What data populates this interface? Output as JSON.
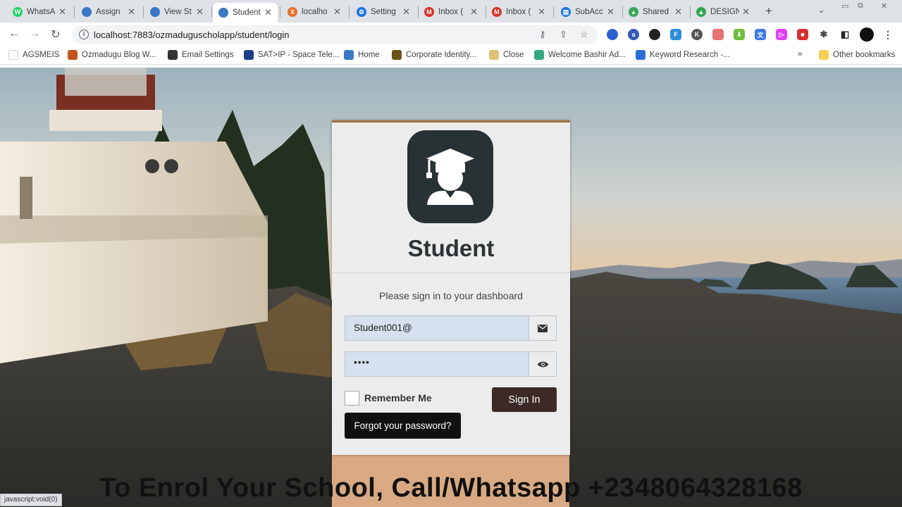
{
  "browser": {
    "tabs": [
      {
        "label": "WhatsA",
        "icon": "whatsapp-icon",
        "color": "#25d366",
        "glyph": "W"
      },
      {
        "label": "Assign",
        "icon": "globe-icon",
        "color": "#3b78c4",
        "glyph": ""
      },
      {
        "label": "View St",
        "icon": "globe-icon",
        "color": "#3b78c4",
        "glyph": ""
      },
      {
        "label": "Student",
        "icon": "globe-icon",
        "color": "#3b78c4",
        "glyph": "",
        "active": true
      },
      {
        "label": "localho",
        "icon": "xampp-icon",
        "color": "#e8702a",
        "glyph": "X"
      },
      {
        "label": "Setting",
        "icon": "gear-icon",
        "color": "#1a73e8",
        "glyph": "⚙"
      },
      {
        "label": "Inbox (",
        "icon": "gmail-icon",
        "color": "#d93025",
        "glyph": "M"
      },
      {
        "label": "Inbox (",
        "icon": "gmail-icon",
        "color": "#d93025",
        "glyph": "M"
      },
      {
        "label": "SubAcc",
        "icon": "sheet-icon",
        "color": "#1a73e8",
        "glyph": "▤"
      },
      {
        "label": "Shared",
        "icon": "drive-icon",
        "color": "#34a853",
        "glyph": "▲"
      },
      {
        "label": "DESIGN",
        "icon": "drive-icon",
        "color": "#34a853",
        "glyph": "▲"
      }
    ],
    "url": "localhost:7883/ozmaduguscholapp/student/login",
    "bookmarks": [
      {
        "label": "AGSMEIS",
        "icon": "bookmark-blank-icon",
        "color": "#ffffff"
      },
      {
        "label": "Ozmadugu Blog W...",
        "icon": "blog-icon",
        "color": "#c0561e"
      },
      {
        "label": "Email Settings",
        "icon": "settings-icon",
        "color": "#333333"
      },
      {
        "label": "SAT>IP - Space Tele...",
        "icon": "satellite-icon",
        "color": "#1d3c8a"
      },
      {
        "label": "Home",
        "icon": "globe-icon",
        "color": "#3b78c4"
      },
      {
        "label": "Corporate Identity...",
        "icon": "corporate-icon",
        "color": "#6b5316"
      },
      {
        "label": "Close",
        "icon": "close-bookmark-icon",
        "color": "#e0c074"
      },
      {
        "label": "Welcome Bashir Ad...",
        "icon": "welcome-icon",
        "color": "#35a87e"
      },
      {
        "label": "Keyword Research -...",
        "icon": "bing-icon",
        "color": "#2a6ed6"
      }
    ],
    "bookmarks_overflow": "»",
    "other_bookmarks": "Other bookmarks"
  },
  "login": {
    "title": "Student",
    "subtitle": "Please sign in to your dashboard",
    "email_value": "Student001@",
    "password_value": "••••",
    "remember_label": "Remember Me",
    "remember_checked": false,
    "signin_label": "Sign In",
    "forgot_label": "Forgot your password?"
  },
  "status_bar_text": "javascript:void(0)",
  "caption": "To Enrol Your School, Call/Whatsapp +2348064328168"
}
